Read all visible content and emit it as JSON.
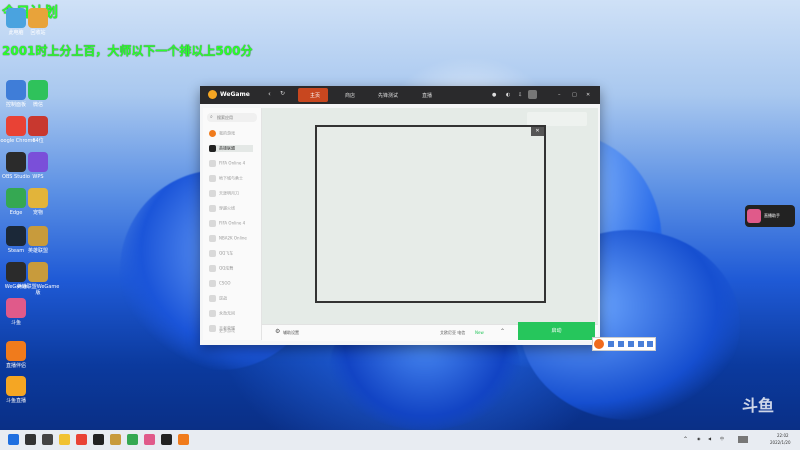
{
  "overlay": {
    "line1": "今日计划",
    "line2": "2001时上分上百，大师以下一个排以上500分"
  },
  "desktop_icons": [
    {
      "label": "此电脑",
      "color": "#4aa3df",
      "icon": "computer-icon"
    },
    {
      "label": "回收站",
      "color": "#e8a33a",
      "icon": "recycle-bin-icon"
    },
    {
      "label": "控制面板",
      "color": "#3f7dd8",
      "icon": "control-panel-icon"
    },
    {
      "label": "微信",
      "color": "#2fc25b",
      "icon": "wechat-icon"
    },
    {
      "label": "Google Chrome",
      "color": "#e94235",
      "icon": "chrome-icon"
    },
    {
      "label": "64位",
      "color": "#c8382f",
      "icon": "app-64-icon"
    },
    {
      "label": "OBS Studio",
      "color": "#2b2b2b",
      "icon": "obs-icon"
    },
    {
      "label": "WPS",
      "color": "#7a4fd9",
      "icon": "wps-icon"
    },
    {
      "label": "Edge",
      "color": "#35a852",
      "icon": "edge-icon"
    },
    {
      "label": "宠物",
      "color": "#e2b43a",
      "icon": "pet-app-icon"
    },
    {
      "label": "Steam",
      "color": "#1b2838",
      "icon": "steam-icon"
    },
    {
      "label": "英雄联盟",
      "color": "#c89b3c",
      "icon": "lol-icon"
    },
    {
      "label": "WeGame",
      "color": "#2b2b2b",
      "icon": "wegame-icon"
    },
    {
      "label": "英雄联盟WeGame版",
      "color": "#c89b3c",
      "icon": "lol-wegame-icon"
    },
    {
      "label": "斗鱼",
      "color": "#e05a8a",
      "icon": "douyu-icon"
    },
    {
      "label": "直播伴侣",
      "color": "#f07b1c",
      "icon": "live-assistant-icon"
    },
    {
      "label": "斗鱼直播",
      "color": "#f5a623",
      "icon": "douyu-live-icon"
    }
  ],
  "wegame": {
    "logo": "WeGame",
    "tabs": [
      "主页",
      "商店",
      "先锋测试",
      "直播"
    ],
    "sidebar_search": "搜索应用",
    "sidebar_items": [
      "我的游戏",
      "英雄联盟",
      "FIFA Online 4",
      "地下城与勇士",
      "天涯明月刀",
      "穿越火线",
      "FIFA Online 4",
      "NBA2K Online",
      "QQ飞车",
      "QQ炫舞",
      "CSGO",
      "逆战",
      "永劫无间",
      "王者荣耀"
    ],
    "sidebar_footer": "更多游戏",
    "bottom_settings": "辅助设置",
    "bottom_status": "艾欧尼亚 电信",
    "bottom_badge": "New",
    "start_button": "启动"
  },
  "float_widget": "直播助手",
  "watermark": "斗鱼",
  "taskbar": {
    "time": "22:02",
    "date": "2022/1/20",
    "apps": [
      {
        "name": "start-icon",
        "color": "#1f6fe0"
      },
      {
        "name": "search-icon",
        "color": "#333333"
      },
      {
        "name": "task-view-icon",
        "color": "#444444"
      },
      {
        "name": "file-explorer-icon",
        "color": "#f1c232"
      },
      {
        "name": "chrome-icon",
        "color": "#e94235"
      },
      {
        "name": "wegame-icon",
        "color": "#222222"
      },
      {
        "name": "lol-icon",
        "color": "#c89b3c"
      },
      {
        "name": "edge-icon",
        "color": "#35a852"
      },
      {
        "name": "douyu-icon",
        "color": "#e05a8a"
      },
      {
        "name": "obs-icon",
        "color": "#222222"
      },
      {
        "name": "live-assistant-icon",
        "color": "#f07b1c"
      }
    ]
  }
}
